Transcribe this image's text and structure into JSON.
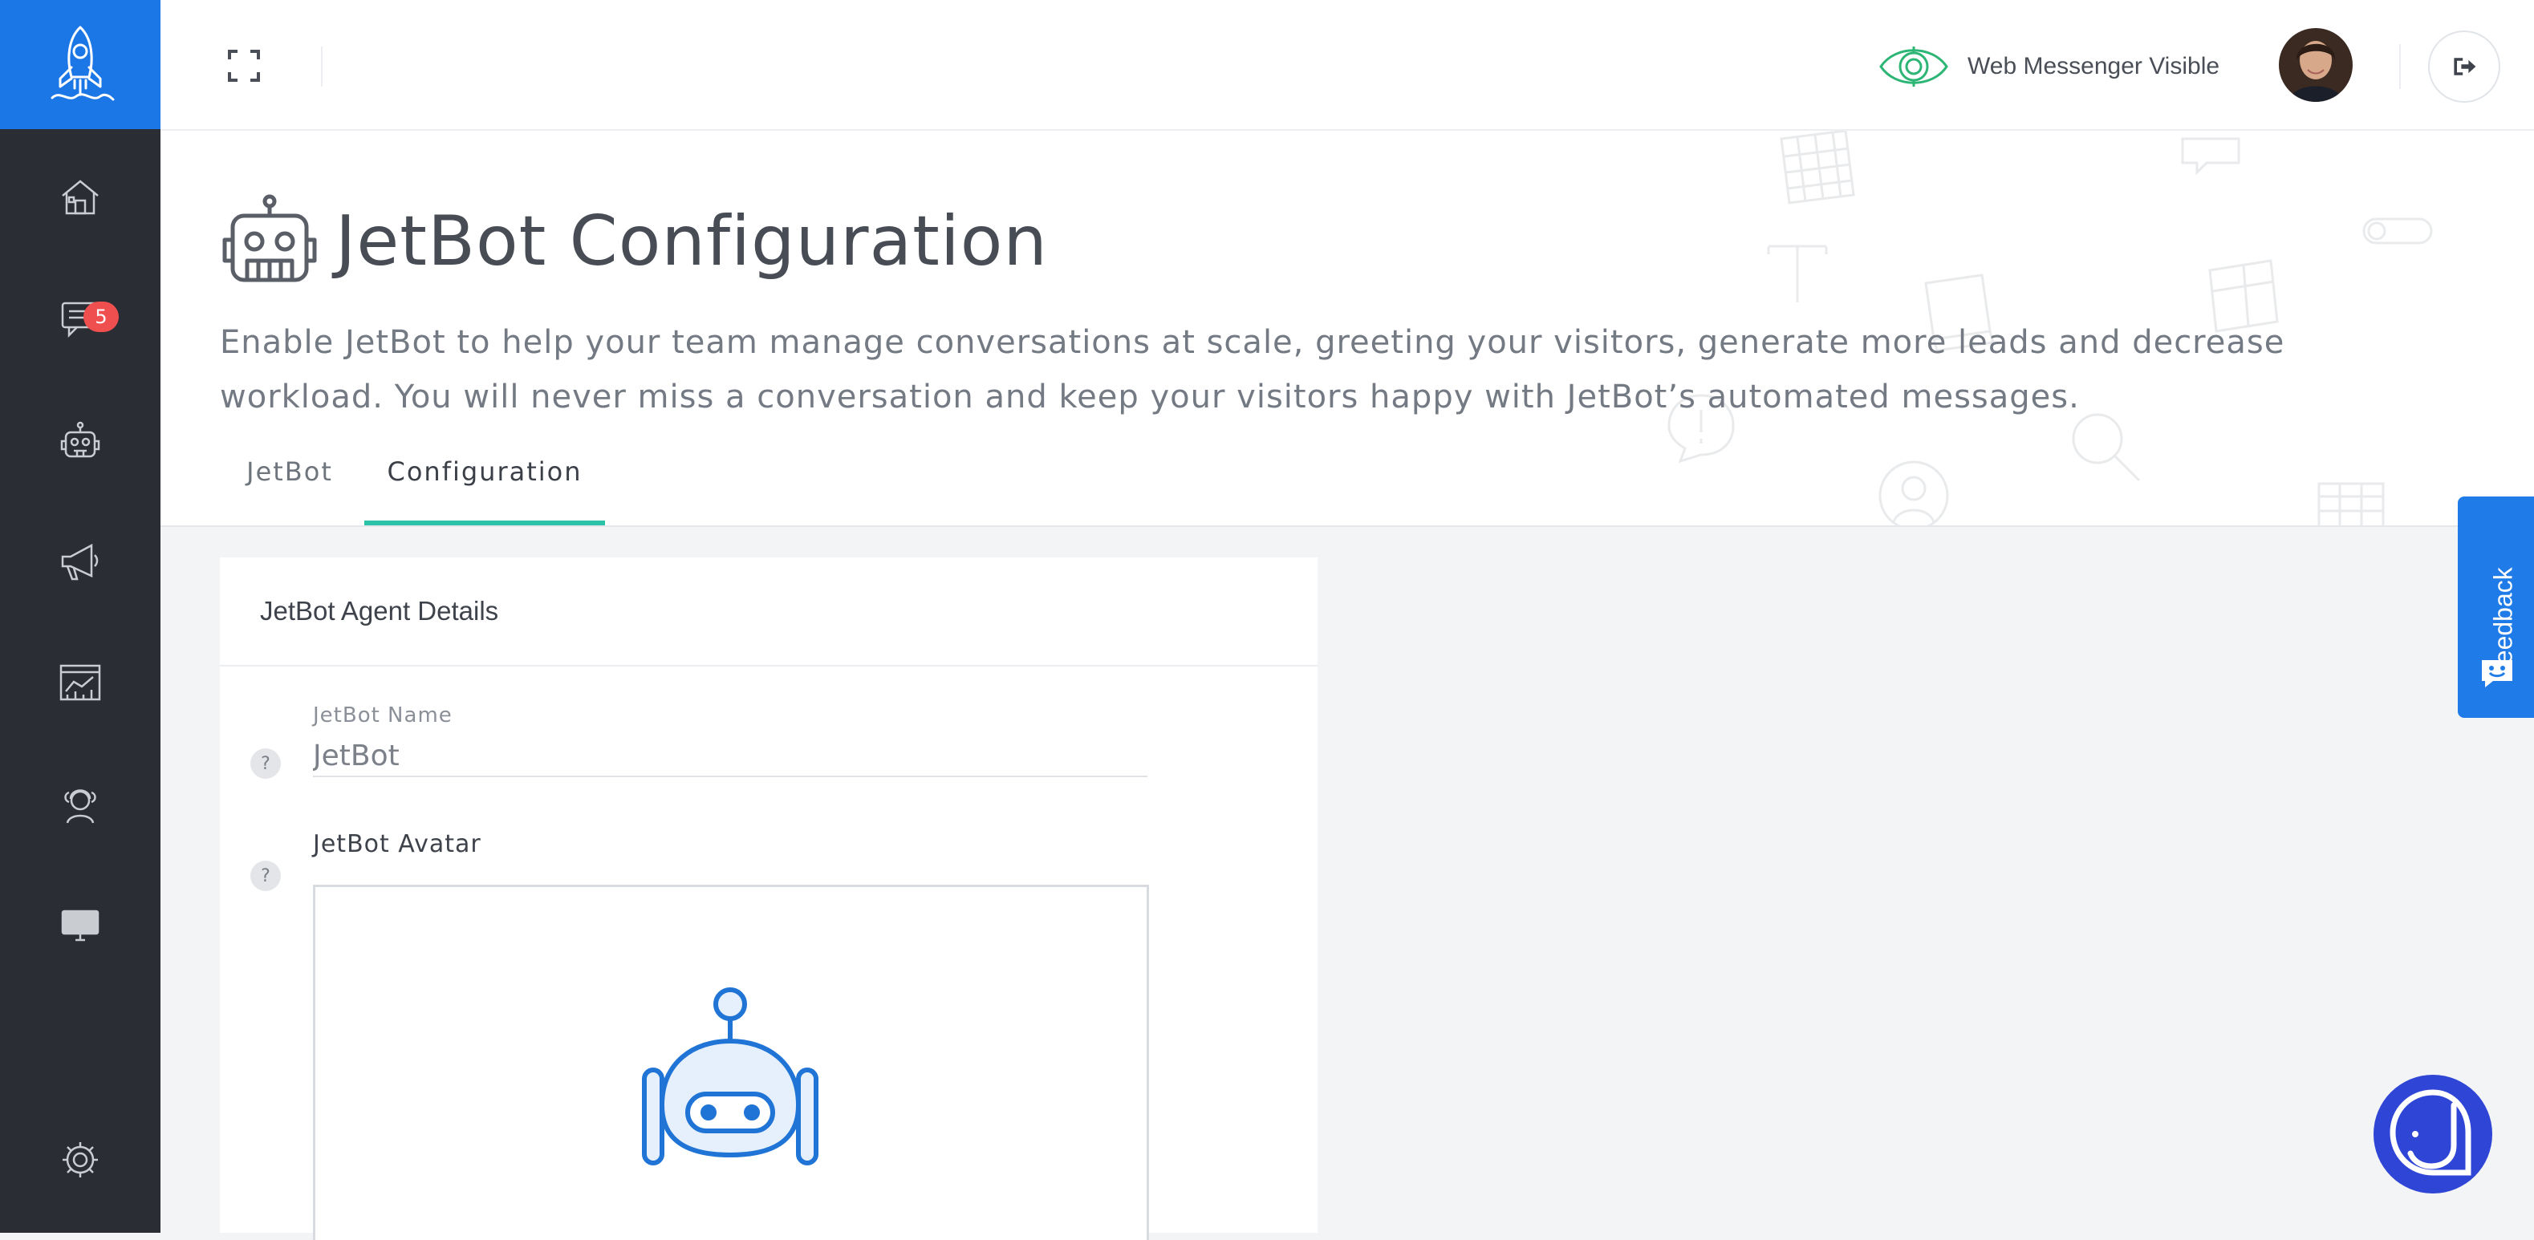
{
  "sidebar": {
    "logo_icon": "rocket-icon",
    "items": [
      {
        "icon": "home-icon"
      },
      {
        "icon": "conversations-icon",
        "badge": "5"
      },
      {
        "icon": "robot-icon"
      },
      {
        "icon": "megaphone-icon"
      },
      {
        "icon": "analytics-icon"
      },
      {
        "icon": "team-icon"
      },
      {
        "icon": "desktop-icon"
      },
      {
        "icon": "settings-icon"
      }
    ]
  },
  "topbar": {
    "expand_icon": "fullscreen-icon",
    "visibility_label": "Web Messenger Visible",
    "visibility_icon": "eye-icon",
    "logout_icon": "logout-icon"
  },
  "header": {
    "title": "JetBot Configuration",
    "description": "Enable JetBot to help your team manage conversations at scale, greeting your visitors, generate more leads and decrease workload. You will never miss a conversation and keep your visitors happy with JetBot’s automated messages.",
    "tabs": [
      {
        "label": "JetBot",
        "active": false
      },
      {
        "label": "Configuration",
        "active": true
      }
    ]
  },
  "card": {
    "title": "JetBot Agent Details",
    "name_field": {
      "label": "JetBot Name",
      "value": "JetBot",
      "help": "?"
    },
    "avatar_field": {
      "label": "JetBot Avatar",
      "help": "?"
    }
  },
  "feedback": {
    "label": "Feedback"
  },
  "colors": {
    "primary": "#1b76e6",
    "sidebar": "#2a2d33",
    "tab_active": "#2bc2a8",
    "badge": "#ef4f4f",
    "chat": "#2f45d6"
  }
}
